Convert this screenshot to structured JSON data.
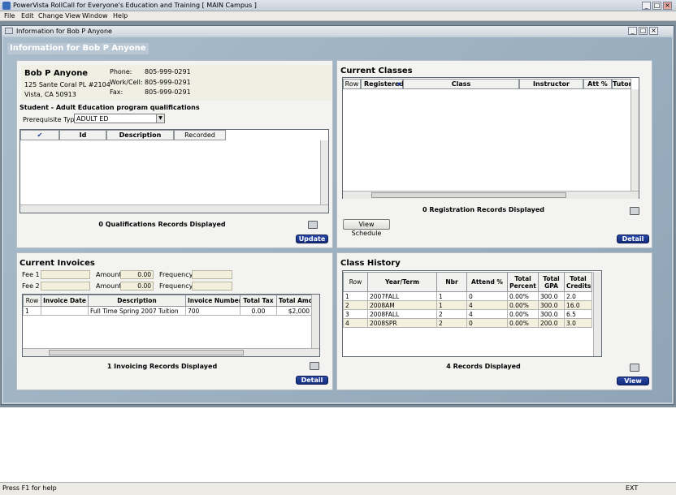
{
  "app": {
    "title": "PowerVista RollCall for Everyone's Education and Training   [ MAIN Campus ]"
  },
  "menu": [
    "File",
    "Edit",
    "Change View",
    "Window",
    "Help"
  ],
  "child_window": {
    "title": "Information for Bob P Anyone"
  },
  "header_label": "Information for Bob P Anyone",
  "person": {
    "name": "Bob P Anyone",
    "address1": "125 Sante Coral PL #2104",
    "address2": "Vista, CA 50913",
    "phone_label": "Phone:",
    "phone": "805-999-0291",
    "work_label": "Work/Cell:",
    "work": "805-999-0291",
    "fax_label": "Fax:",
    "fax": "805-999-0291"
  },
  "qualifications": {
    "heading": "Student - Adult Education program qualifications",
    "prereq_label": "Prerequisite Type",
    "prereq_value": "ADULT ED",
    "columns": [
      "✔",
      "Id",
      "Description",
      "Recorded"
    ],
    "status": "0 Qualifications Records Displayed",
    "update_label": "Update"
  },
  "current_classes": {
    "title": "Current Classes",
    "columns": [
      "Row",
      "Registered",
      "Class",
      "Instructor",
      "Att %",
      "Tutor"
    ],
    "status": "0 Registration Records Displayed",
    "view_schedule_label": "View Schedule",
    "detail_label": "Detail"
  },
  "invoices": {
    "title": "Current Invoices",
    "fee1_label": "Fee 1",
    "fee2_label": "Fee 2",
    "amount_label": "Amount",
    "amount1": "0.00",
    "amount2": "0.00",
    "frequency_label": "Frequency",
    "columns": [
      "Row",
      "Invoice Date",
      "Description",
      "Invoice Number",
      "Total Tax",
      "Total Amount"
    ],
    "rows": [
      [
        "1",
        "",
        "Full Time Spring 2007 Tuition",
        "700",
        "0.00",
        "$2,000"
      ]
    ],
    "status": "1 Invoicing Records Displayed",
    "detail_label": "Detail"
  },
  "class_history": {
    "title": "Class History",
    "columns": [
      "Row",
      "Year/Term",
      "Nbr",
      "Attend %",
      "Total Percent",
      "Total GPA",
      "Total Credits"
    ],
    "rows": [
      [
        "1",
        "2007FALL",
        "1",
        "0",
        "0.00%",
        "300.0",
        "2.0"
      ],
      [
        "2",
        "2008AM",
        "1",
        "4",
        "0.00%",
        "300.0",
        "16.0"
      ],
      [
        "3",
        "2008FALL",
        "2",
        "4",
        "0.00%",
        "300.0",
        "6.5"
      ],
      [
        "4",
        "2008SPR",
        "2",
        "0",
        "0.00%",
        "200.0",
        "3.0"
      ]
    ],
    "status": "4 Records Displayed",
    "view_label": "View"
  },
  "statusbar": {
    "help": "Press F1 for help",
    "ext": "EXT"
  }
}
